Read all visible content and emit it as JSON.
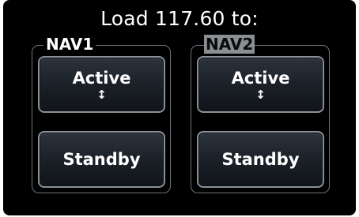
{
  "dialog": {
    "title": "Load 117.60 to:"
  },
  "groups": [
    {
      "label": "NAV1",
      "selected": false,
      "active_label": "Active",
      "standby_label": "Standby",
      "swap_icon": "↕"
    },
    {
      "label": "NAV2",
      "selected": true,
      "active_label": "Active",
      "standby_label": "Standby",
      "swap_icon": "↕"
    }
  ],
  "colors": {
    "background": "#000000",
    "button_border": "#8a9199",
    "selected_label_bg": "#8a8f94",
    "group_border": "#6f7378"
  }
}
